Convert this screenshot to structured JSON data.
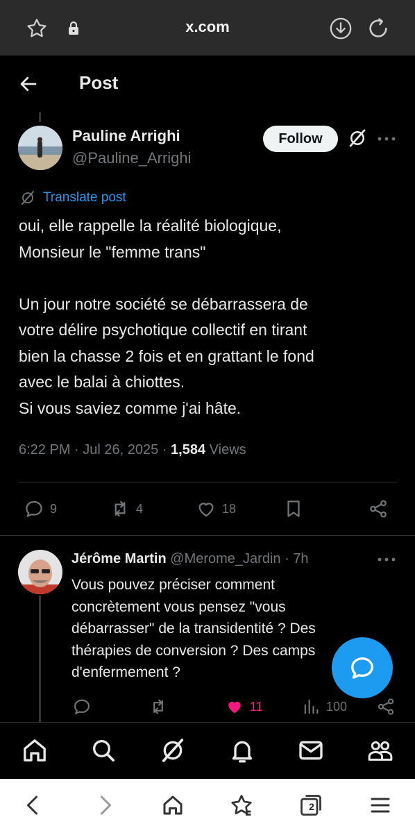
{
  "browser": {
    "url": "x.com",
    "tab_count": "2"
  },
  "header": {
    "title": "Post"
  },
  "post": {
    "author_name": "Pauline Arrighi",
    "author_handle": "@Pauline_Arrighi",
    "follow_label": "Follow",
    "translate_label": "Translate post",
    "text": "oui, elle rappelle la réalité biologique,\nMonsieur le \"femme trans\"\n\nUn jour notre société se débarrassera de\nvotre délire psychotique collectif en tirant\nbien la chasse 2 fois et en grattant le fond\navec le balai à chiottes.\nSi vous saviez comme j'ai hâte.",
    "time": "6:22 PM",
    "date": "Jul 26, 2025",
    "views_count": "1,584",
    "views_label": "Views",
    "replies": "9",
    "reposts": "4",
    "likes": "18"
  },
  "reply": {
    "author_name": "Jérôme Martin",
    "author_handle": "@Merome_Jardin",
    "age": "7h",
    "text": "Vous pouvez préciser comment concrètement vous pensez \"vous débarrasser\" de la transidentité ? Des thérapies de conversion ? Des camps d'enfermement ?",
    "likes": "11",
    "views": "100"
  },
  "colors": {
    "accent": "#1d9bf0",
    "like": "#f91880",
    "muted": "#71767b"
  },
  "icons": [
    "star-icon",
    "lock-icon",
    "download-icon",
    "reload-icon",
    "back-arrow-icon",
    "grok-icon",
    "more-icon",
    "translate-icon",
    "reply-icon",
    "repost-icon",
    "like-icon",
    "bookmark-icon",
    "share-icon",
    "views-icon",
    "chat-icon",
    "home-icon",
    "search-icon",
    "notifications-icon",
    "messages-icon",
    "communities-icon",
    "back-icon",
    "forward-icon",
    "favorites-icon",
    "tabs-icon",
    "menu-icon"
  ]
}
